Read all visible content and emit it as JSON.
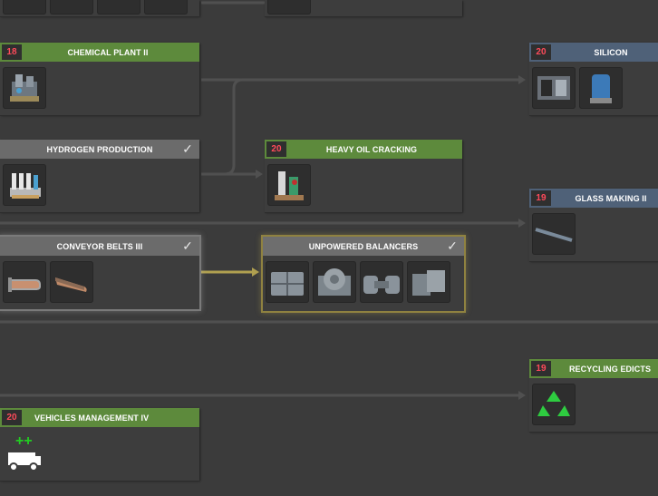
{
  "nodes": {
    "chemical_plant_ii": {
      "level": "18",
      "title": "CHEMICAL PLANT II"
    },
    "hydrogen_production": {
      "title": "HYDROGEN PRODUCTION",
      "check": "✓"
    },
    "conveyor_belts_iii": {
      "title": "CONVEYOR BELTS III",
      "check": "✓"
    },
    "vehicles_management_iv": {
      "level": "20",
      "title": "VEHICLES MANAGEMENT IV"
    },
    "heavy_oil_cracking": {
      "level": "20",
      "title": "HEAVY OIL CRACKING"
    },
    "unpowered_balancers": {
      "title": "UNPOWERED BALANCERS",
      "check": "✓"
    },
    "silicon": {
      "level": "20",
      "title": "SILICON"
    },
    "glass_making_ii": {
      "level": "19",
      "title": "GLASS MAKING II"
    },
    "recycling_edicts": {
      "level": "19",
      "title": "RECYCLING EDICTS"
    }
  },
  "colors": {
    "background": "#3b3b3b",
    "header_green": "#5d8a3c",
    "header_blue": "#4f6178",
    "header_gray": "#6b6b6b",
    "level_text": "#ff4a5a",
    "link_line": "#4f4f4f",
    "link_active": "#b0a050"
  }
}
